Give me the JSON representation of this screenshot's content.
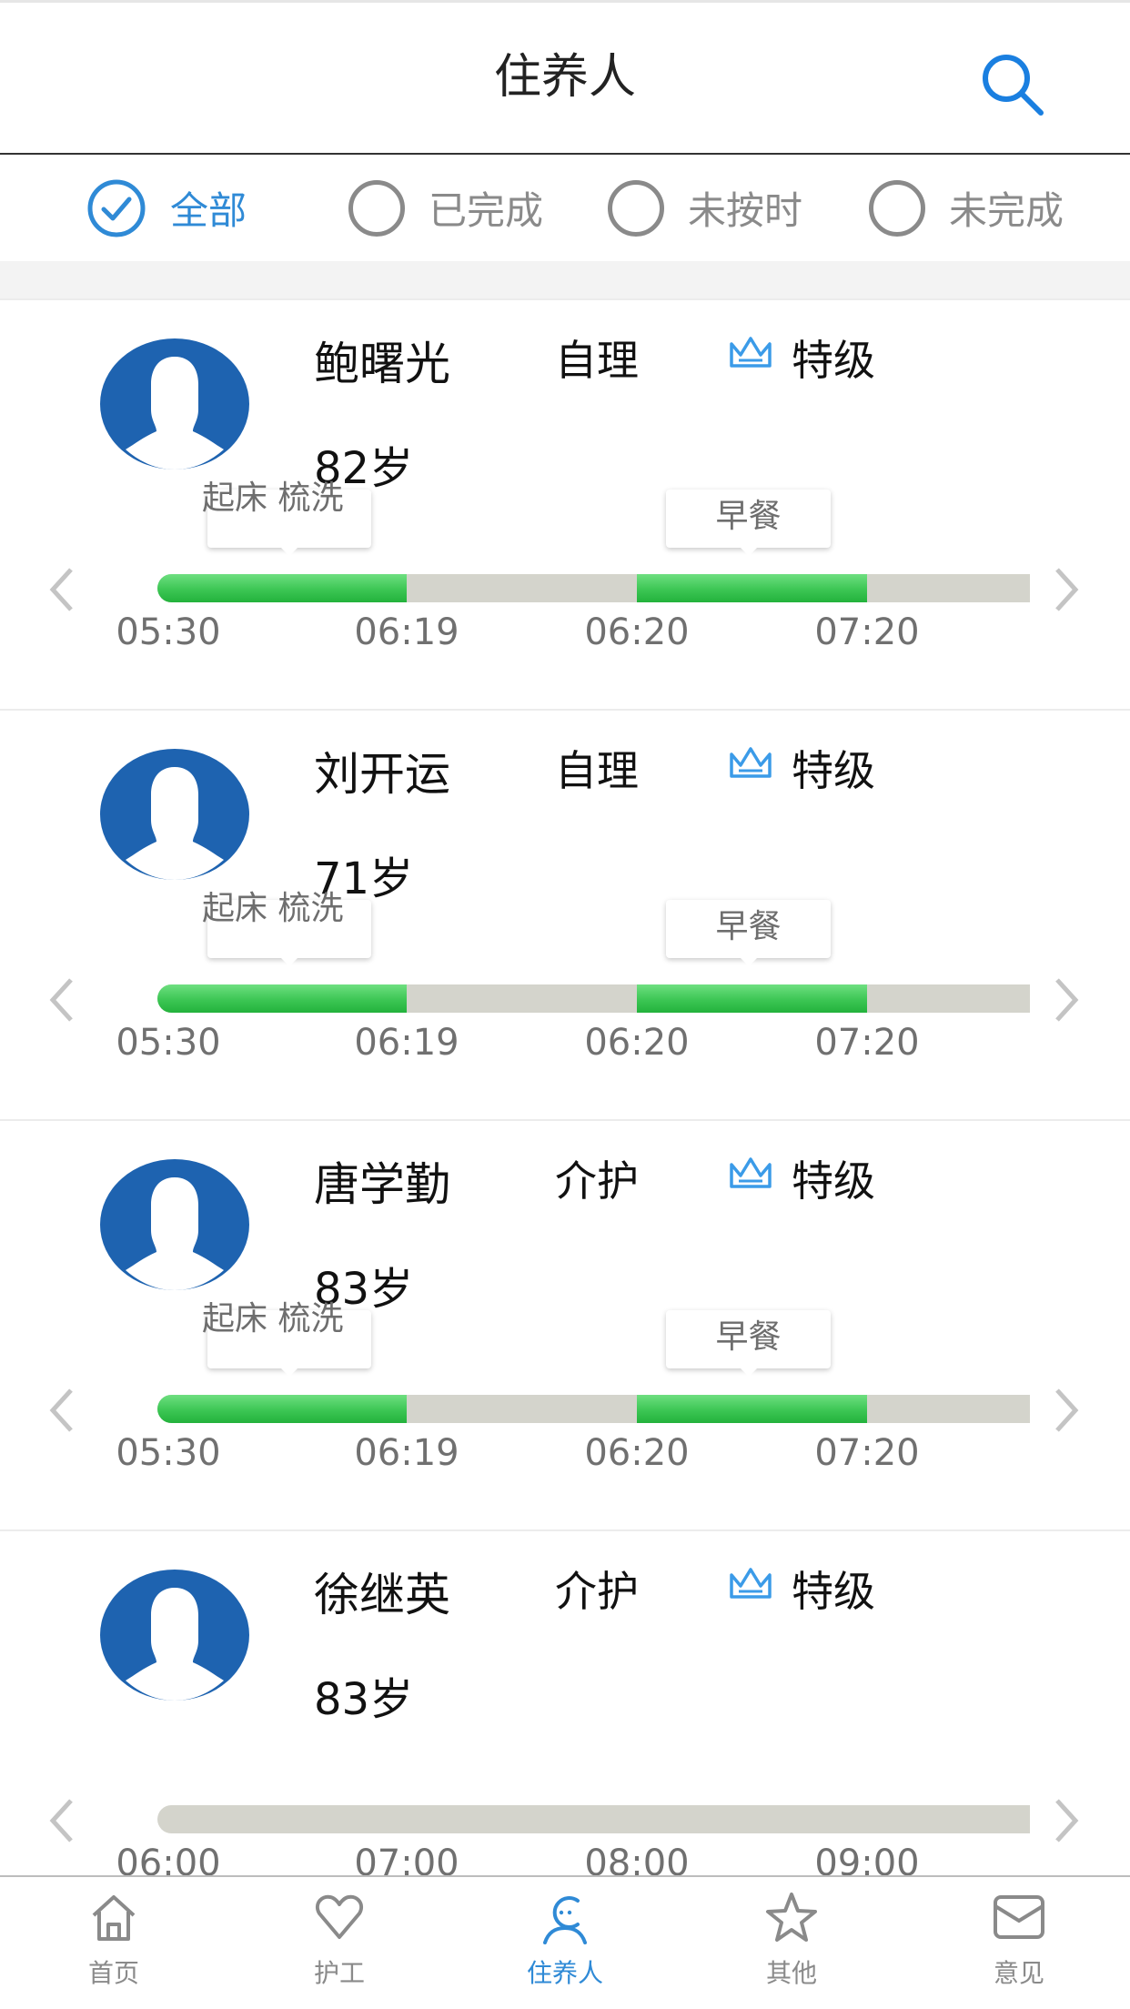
{
  "header": {
    "title": "住养人",
    "search_icon": "search-icon"
  },
  "filters": [
    {
      "label": "全部",
      "selected": true
    },
    {
      "label": "已完成",
      "selected": false
    },
    {
      "label": "未按时",
      "selected": false
    },
    {
      "label": "未完成",
      "selected": false
    }
  ],
  "colors": {
    "accent": "#2f8ad6",
    "avatar": "#1e63b0",
    "progress_done": "#3cc654",
    "progress_pending": "#d4d4cc"
  },
  "residents": [
    {
      "name": "鲍曙光",
      "care_type": "自理",
      "level": "特级",
      "age": "82岁",
      "tasks": [
        {
          "label": "起床 梳洗"
        },
        {
          "label": "早餐"
        }
      ],
      "progress_segments": [
        {
          "from": "05:30",
          "to": "06:19",
          "status": "done"
        },
        {
          "from": "06:19",
          "to": "06:20",
          "status": "pending"
        },
        {
          "from": "06:20",
          "to": "07:20",
          "status": "done"
        },
        {
          "from": "07:20",
          "to": "",
          "status": "pending"
        }
      ],
      "time_labels": [
        "05:30",
        "06:19",
        "06:20",
        "07:20"
      ]
    },
    {
      "name": "刘开运",
      "care_type": "自理",
      "level": "特级",
      "age": "71岁",
      "tasks": [
        {
          "label": "起床 梳洗"
        },
        {
          "label": "早餐"
        }
      ],
      "progress_segments": [
        {
          "from": "05:30",
          "to": "06:19",
          "status": "done"
        },
        {
          "from": "06:19",
          "to": "06:20",
          "status": "pending"
        },
        {
          "from": "06:20",
          "to": "07:20",
          "status": "done"
        },
        {
          "from": "07:20",
          "to": "",
          "status": "pending"
        }
      ],
      "time_labels": [
        "05:30",
        "06:19",
        "06:20",
        "07:20"
      ]
    },
    {
      "name": "唐学勤",
      "care_type": "介护",
      "level": "特级",
      "age": "83岁",
      "tasks": [
        {
          "label": "起床 梳洗"
        },
        {
          "label": "早餐"
        }
      ],
      "progress_segments": [
        {
          "from": "05:30",
          "to": "06:19",
          "status": "done"
        },
        {
          "from": "06:19",
          "to": "06:20",
          "status": "pending"
        },
        {
          "from": "06:20",
          "to": "07:20",
          "status": "done"
        },
        {
          "from": "07:20",
          "to": "",
          "status": "pending"
        }
      ],
      "time_labels": [
        "05:30",
        "06:19",
        "06:20",
        "07:20"
      ]
    },
    {
      "name": "徐继英",
      "care_type": "介护",
      "level": "特级",
      "age": "83岁",
      "tasks": [],
      "progress_segments": [],
      "time_labels": [
        "06:00",
        "07:00",
        "08:00",
        "09:00"
      ]
    }
  ],
  "bottom_nav": [
    {
      "label": "首页",
      "icon": "home-icon",
      "active": false
    },
    {
      "label": "护工",
      "icon": "heart-icon",
      "active": false
    },
    {
      "label": "住养人",
      "icon": "resident-icon",
      "active": true
    },
    {
      "label": "其他",
      "icon": "star-icon",
      "active": false
    },
    {
      "label": "意见",
      "icon": "mail-icon",
      "active": false
    }
  ]
}
